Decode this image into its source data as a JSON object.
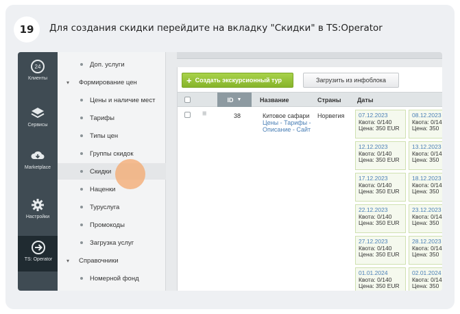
{
  "step": {
    "number": "19",
    "text": "Для создания скидки перейдите на вкладку \"Скидки\" в TS:Operator"
  },
  "app_sidebar": [
    {
      "label": "Клиенты",
      "icon": "clock-24-icon"
    },
    {
      "label": "Сервисы",
      "icon": "layers-icon"
    },
    {
      "label": "Marketplace",
      "icon": "cloud-download-icon"
    },
    {
      "label": "Настройки",
      "icon": "gear-icon"
    },
    {
      "label": "TS: Operator",
      "icon": "arrow-circle-icon",
      "active": true
    }
  ],
  "menu": [
    {
      "label": "Доп. услуги",
      "type": "item"
    },
    {
      "label": "Формирование цен",
      "type": "group"
    },
    {
      "label": "Цены и наличие мест",
      "type": "item"
    },
    {
      "label": "Тарифы",
      "type": "item"
    },
    {
      "label": "Типы цен",
      "type": "item"
    },
    {
      "label": "Группы скидок",
      "type": "item"
    },
    {
      "label": "Скидки",
      "type": "item",
      "selected": true
    },
    {
      "label": "Наценки",
      "type": "item"
    },
    {
      "label": "Туруслуга",
      "type": "item"
    },
    {
      "label": "Промокоды",
      "type": "item"
    },
    {
      "label": "Загрузка услуг",
      "type": "item"
    },
    {
      "label": "Справочники",
      "type": "group"
    },
    {
      "label": "Номерной фонд",
      "type": "item"
    }
  ],
  "toolbar": {
    "create_label": "Создать экскурсионный тур",
    "load_label": "Загрузить из инфоблока"
  },
  "table": {
    "headers": {
      "id": "ID",
      "name": "Название",
      "countries": "Страны",
      "dates": "Даты"
    },
    "row": {
      "id": "38",
      "name": "Китовое сафари",
      "links": "Цены - Тарифы - Описание - Сайт",
      "country": "Норвегия"
    },
    "dates_col1": [
      {
        "date": "07.12.2023",
        "quota": "Квота: 0/140",
        "price": "Цена: 350 EUR"
      },
      {
        "date": "12.12.2023",
        "quota": "Квота: 0/140",
        "price": "Цена: 350 EUR"
      },
      {
        "date": "17.12.2023",
        "quota": "Квота: 0/140",
        "price": "Цена: 350 EUR"
      },
      {
        "date": "22.12.2023",
        "quota": "Квота: 0/140",
        "price": "Цена: 350 EUR"
      },
      {
        "date": "27.12.2023",
        "quota": "Квота: 0/140",
        "price": "Цена: 350 EUR"
      },
      {
        "date": "01.01.2024",
        "quota": "Квота: 0/140",
        "price": "Цена: 350 EUR"
      }
    ],
    "dates_col2": [
      {
        "date": "08.12.2023",
        "quota": "Квота: 0/14",
        "price": "Цена: 350"
      },
      {
        "date": "13.12.2023",
        "quota": "Квота: 0/14",
        "price": "Цена: 350"
      },
      {
        "date": "18.12.2023",
        "quota": "Квота: 0/14",
        "price": "Цена: 350"
      },
      {
        "date": "23.12.2023",
        "quota": "Квота: 0/14",
        "price": "Цена: 350"
      },
      {
        "date": "28.12.2023",
        "quota": "Квота: 0/14",
        "price": "Цена: 350"
      },
      {
        "date": "02.01.2024",
        "quota": "Квота: 0/14",
        "price": "Цена: 350"
      }
    ]
  }
}
